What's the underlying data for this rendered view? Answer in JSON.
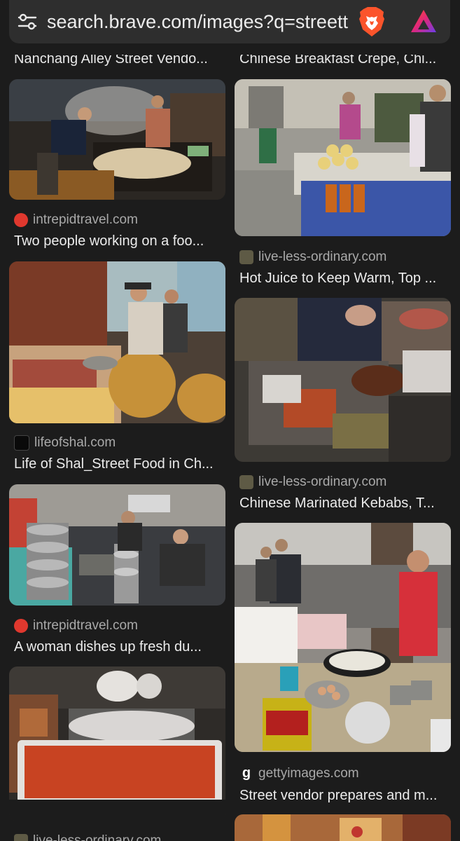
{
  "browser": {
    "url": "search.brave.com/images?q=streett",
    "icons": {
      "site_settings": "tune-icon",
      "shields": "brave-lion-icon",
      "rewards": "brave-rewards-icon"
    }
  },
  "results": {
    "top_left_title": "Nanchang Alley Street Vendo...",
    "top_right_title": "Chinese Breakfast Crepe, Chi...",
    "items": [
      {
        "source": "intrepidtravel.com",
        "title": "Two people working on a foo..."
      },
      {
        "source": "live-less-ordinary.com",
        "title": "Hot Juice to Keep Warm, Top ..."
      },
      {
        "source": "lifeofshal.com",
        "title": "Life of Shal_Street Food in Ch..."
      },
      {
        "source": "live-less-ordinary.com",
        "title": "Chinese Marinated Kebabs, T..."
      },
      {
        "source": "intrepidtravel.com",
        "title": "A woman dishes up fresh du..."
      },
      {
        "source": "gettyimages.com",
        "title": "Street vendor prepares and m..."
      },
      {
        "source": "live-less-ordinary.com",
        "title": ""
      }
    ]
  },
  "colors": {
    "background": "#1c1c1c",
    "urlbar": "#2e2e2e",
    "brave_orange": "#fb542b",
    "intrepid_red": "#e0382e"
  }
}
